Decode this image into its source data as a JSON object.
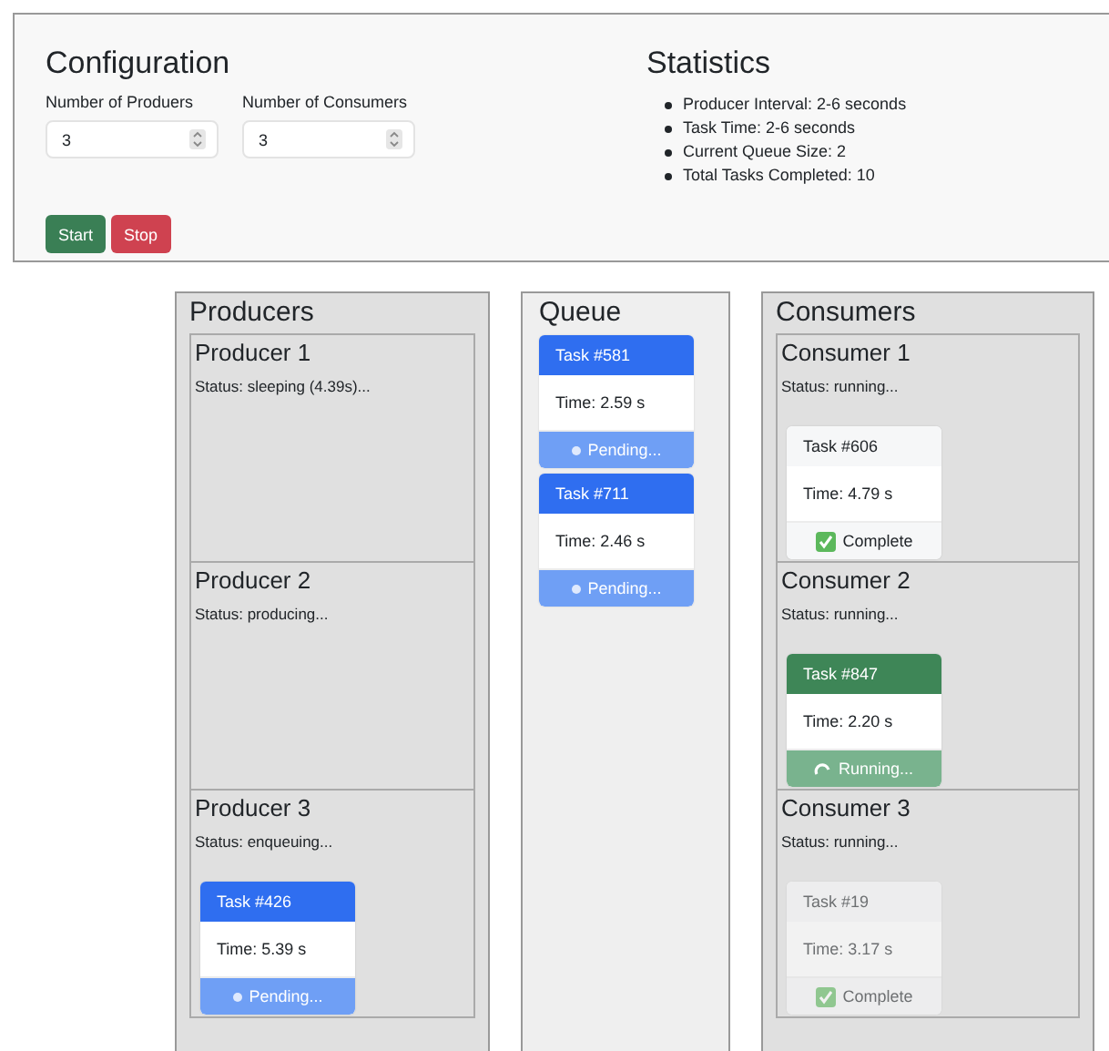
{
  "config": {
    "title": "Configuration",
    "fields": [
      {
        "label": "Number of Produers",
        "value": "3"
      },
      {
        "label": "Number of Consumers",
        "value": "3"
      }
    ],
    "buttons": [
      {
        "label": "Start",
        "kind": "start"
      },
      {
        "label": "Stop",
        "kind": "stop"
      }
    ]
  },
  "statistics": {
    "title": "Statistics",
    "items": [
      "Producer Interval: 2-6 seconds",
      "Task Time: 2-6 seconds",
      "Current Queue Size: 2",
      "Total Tasks Completed: 10"
    ]
  },
  "producers": {
    "title": "Producers",
    "items": [
      {
        "name": "Producer 1",
        "status": "Status: sleeping (4.39s)..."
      },
      {
        "name": "Producer 2",
        "status": "Status: producing..."
      },
      {
        "name": "Producer 3",
        "status": "Status: enqueuing...",
        "task": {
          "title": "Task #426",
          "time": "Time: 5.39 s",
          "kind": "pending",
          "footer": "Pending...",
          "dimmed": false
        }
      }
    ]
  },
  "queue": {
    "title": "Queue",
    "tasks": [
      {
        "title": "Task #581",
        "time": "Time: 2.59 s",
        "kind": "pending",
        "footer": "Pending...",
        "dimmed": false
      },
      {
        "title": "Task #711",
        "time": "Time: 2.46 s",
        "kind": "pending",
        "footer": "Pending...",
        "dimmed": false
      }
    ]
  },
  "consumers": {
    "title": "Consumers",
    "items": [
      {
        "name": "Consumer 1",
        "status": "Status: running...",
        "task": {
          "title": "Task #606",
          "time": "Time: 4.79 s",
          "kind": "complete",
          "footer": "Complete",
          "dimmed": false
        }
      },
      {
        "name": "Consumer 2",
        "status": "Status: running...",
        "task": {
          "title": "Task #847",
          "time": "Time: 2.20 s",
          "kind": "running",
          "footer": "Running...",
          "dimmed": false
        }
      },
      {
        "name": "Consumer 3",
        "status": "Status: running...",
        "task": {
          "title": "Task #19",
          "time": "Time: 3.17 s",
          "kind": "complete",
          "footer": "Complete",
          "dimmed": true
        }
      }
    ]
  }
}
